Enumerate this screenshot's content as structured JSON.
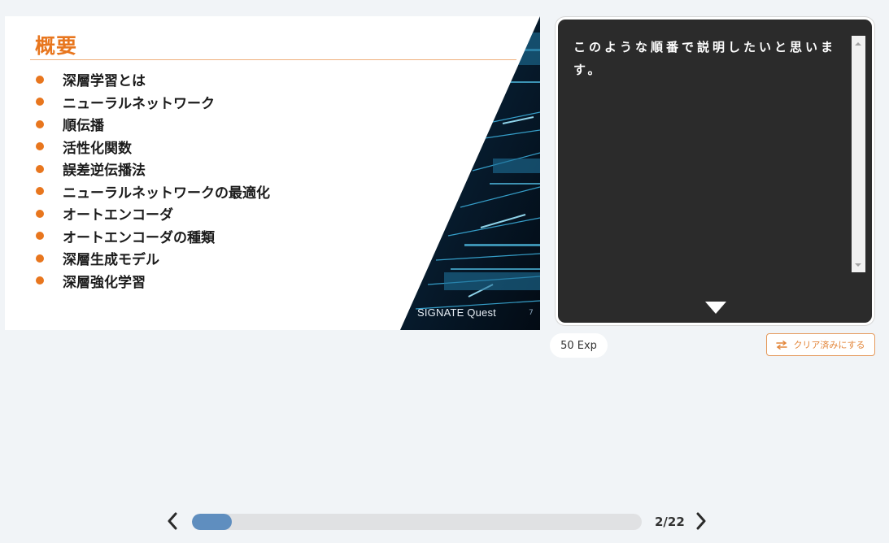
{
  "slide": {
    "title": "概要",
    "items": [
      "深層学習とは",
      "ニューラルネットワーク",
      "順伝播",
      "活性化関数",
      "誤差逆伝播法",
      "ニューラルネットワークの最適化",
      "オートエンコーダ",
      "オートエンコーダの種類",
      "深層生成モデル",
      "深層強化学習"
    ],
    "brand": "SIGNATE Quest",
    "page_number": "7",
    "accent_color": "#e8761e"
  },
  "narration": {
    "text": "このような順番で説明したいと思います。",
    "next_icon": "triangle-down-icon"
  },
  "exp_badge": "50 Exp",
  "clear_button": {
    "label": "クリア済みにする",
    "icon": "swap-arrows-icon"
  },
  "pager": {
    "counter": "2/22",
    "current": 2,
    "total": 22,
    "prev_icon": "chevron-left-icon",
    "next_icon": "chevron-right-icon"
  }
}
